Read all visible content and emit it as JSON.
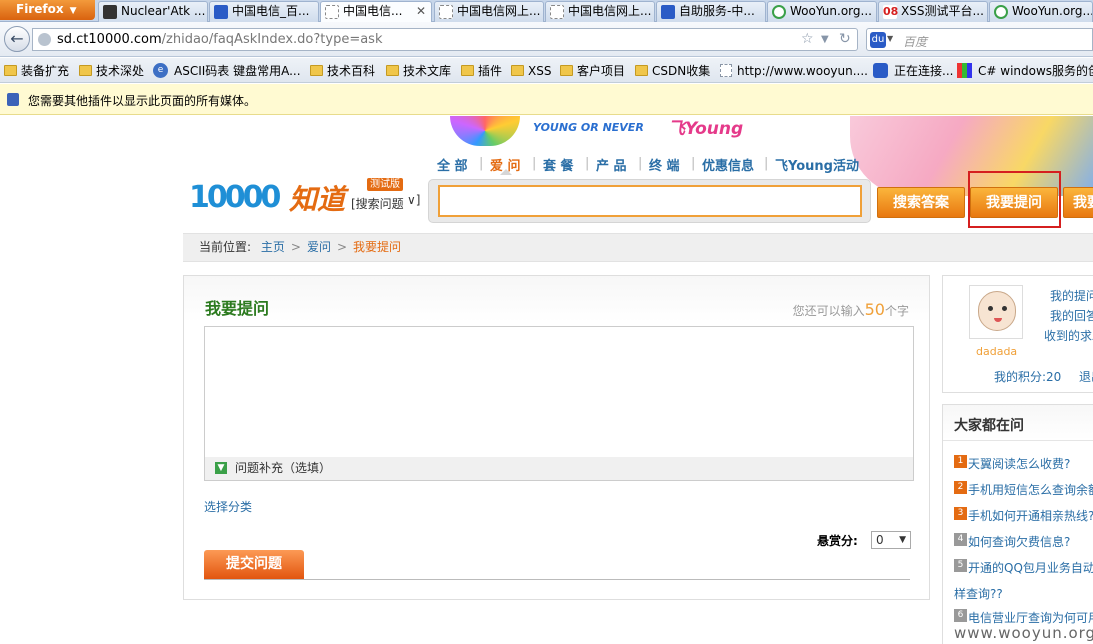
{
  "browser": {
    "app_name": "Firefox",
    "tabs": [
      {
        "label": "Nuclear'Atk ...",
        "color": "#333333"
      },
      {
        "label": "中国电信_百...",
        "color": "#2a5bc6"
      },
      {
        "label": "中国电信...",
        "color": "#ffffff",
        "active": true
      },
      {
        "label": "中国电信网上...",
        "color": "#ffffff"
      },
      {
        "label": "中国电信网上...",
        "color": "#ffffff"
      },
      {
        "label": "自助服务-中...",
        "color": "#2a5bc6"
      },
      {
        "label": "WooYun.org...",
        "color": "#3aa048"
      },
      {
        "label": "XSS测试平台...",
        "color": "#d51f1f"
      },
      {
        "label": "WooYun.org...",
        "color": "#3aa048"
      }
    ],
    "url_host": "sd.ct10000.com",
    "url_path": "/zhidao/faqAskIndex.do?type=ask",
    "search_placeholder": "百度",
    "bookmarks": [
      "装备扩充",
      "技术深处",
      "ASCII码表 键盘常用A...",
      "技术百科",
      "技术文库",
      "插件",
      "XSS",
      "客户项目",
      "CSDN收集",
      "http://www.wooyun....",
      "正在连接...",
      "C# windows服务的创"
    ],
    "plugin_notice": "您需要其他插件以显示此页面的所有媒体。"
  },
  "banner": {
    "slogan": "YOUNG OR NEVER",
    "young": "飞Young"
  },
  "category_nav": [
    "全 部",
    "爱 问",
    "套 餐",
    "产 品",
    "终 端",
    "优惠信息",
    "飞Young活动"
  ],
  "logo": {
    "number": "10000",
    "zhidao": "知道",
    "beta": "测试版"
  },
  "search": {
    "select_value": "[搜索问题",
    "input_value": "",
    "btn_search": "搜索答案",
    "btn_ask": "我要提问",
    "btn_answer": "我要"
  },
  "breadcrumb": {
    "label": "当前位置:",
    "home": "主页",
    "aiwen": "爱问",
    "current": "我要提问"
  },
  "ask": {
    "title": "我要提问",
    "count_prefix": "您还可以输入",
    "count": "50",
    "count_suffix": "个字",
    "supplement": "问题补充（选填）",
    "choose_category": "选择分类",
    "reward_label": "悬赏分:",
    "reward_value": "0",
    "submit": "提交问题"
  },
  "user": {
    "name": "dadada",
    "my_questions": "我的提问",
    "my_answers": "我的回答",
    "received": "收到的求助",
    "score_label": "我的积分:20",
    "logout": "退出"
  },
  "hot": {
    "title": "大家都在问",
    "items": [
      {
        "rank": "1",
        "text": "天翼阅读怎么收费?"
      },
      {
        "rank": "2",
        "text": "手机用短信怎么查询余额"
      },
      {
        "rank": "3",
        "text": "手机如何开通相亲热线?"
      },
      {
        "rank": "4",
        "text": "如何查询欠费信息?"
      },
      {
        "rank": "5",
        "text": "开通的QQ包月业务自动收费"
      },
      {
        "rank": "",
        "text": "样查询??"
      },
      {
        "rank": "6",
        "text": "电信营业厅查询为何可用"
      }
    ]
  },
  "watermark": "www.wooyun.org"
}
